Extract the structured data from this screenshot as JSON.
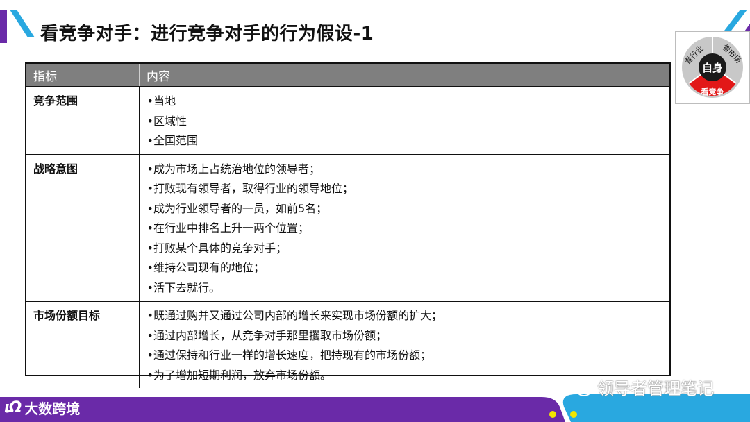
{
  "title": "看竞争对手：进行竞争对手的行为假设-1",
  "logo": {
    "center": "自身",
    "seg_left": "看行业",
    "seg_right": "看市场",
    "seg_bottom": "看竞争",
    "colors": {
      "ring": "#c8c8c8",
      "highlight": "#e21818",
      "center": "#1a1a1a"
    }
  },
  "table": {
    "headers": [
      "指标",
      "内容"
    ],
    "rows": [
      {
        "label": "竞争范围",
        "items": [
          "•当地",
          "•区域性",
          "•全国范围"
        ]
      },
      {
        "label": "战略意图",
        "items": [
          "•成为市场上占统治地位的领导者；",
          "•打败现有领导者，取得行业的领导地位；",
          "•成为行业领导者的一员，如前5名；",
          "•在行业中排名上升一两个位置；",
          "•打败某个具体的竞争对手；",
          "•维持公司现有的地位；",
          "•活下去就行。"
        ]
      },
      {
        "label": "市场份额目标",
        "items": [
          "•既通过购并又通过公司内部的增长来实现市场份额的扩大；",
          "•通过内部增长，从竞争对手那里攫取市场份额；",
          "•通过保持和行业一样的增长速度，把持现有的市场份额；",
          "•为了增加短期利润，放弃市场份额。"
        ]
      }
    ]
  },
  "footer": {
    "brand": "大数跨境",
    "brand_mark": "ιΩ",
    "watermark": "领导者管理笔记"
  },
  "colors": {
    "purple": "#6a2aa8",
    "cyan": "#29a8e0",
    "yellow": "#f2e600",
    "header_gray": "#7f7f7f"
  }
}
